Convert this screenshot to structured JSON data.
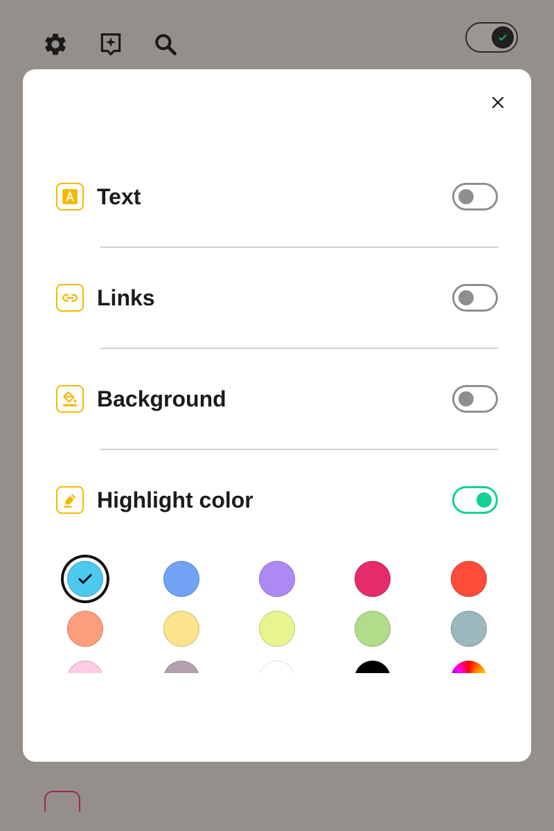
{
  "toolbar": {
    "settings_icon": "gear-icon",
    "sparkle_icon": "sparkle-icon",
    "search_icon": "search-icon",
    "dark_mode_toggle": {
      "state": "on",
      "icon": "check-icon"
    }
  },
  "panel": {
    "close_icon": "close-icon",
    "rows": [
      {
        "label": "Text",
        "icon": "text-a-icon",
        "enabled": false
      },
      {
        "label": "Links",
        "icon": "link-icon",
        "enabled": false
      },
      {
        "label": "Background",
        "icon": "paint-bucket-icon",
        "enabled": false
      },
      {
        "label": "Highlight color",
        "icon": "highlighter-icon",
        "enabled": true
      }
    ],
    "swatches": [
      {
        "color": "#4dc8ef",
        "selected": true
      },
      {
        "color": "#71a2f6",
        "selected": false
      },
      {
        "color": "#ad89f4",
        "selected": false
      },
      {
        "color": "#e52b6b",
        "selected": false
      },
      {
        "color": "#fd4c3a",
        "selected": false
      },
      {
        "color": "#fc9e7c",
        "selected": false
      },
      {
        "color": "#fce38c",
        "selected": false
      },
      {
        "color": "#e8f58f",
        "selected": false
      },
      {
        "color": "#b1dc8a",
        "selected": false
      },
      {
        "color": "#9cb7be",
        "selected": false
      },
      {
        "color": "#fccde4",
        "selected": false
      },
      {
        "color": "#b3a1b0",
        "selected": false
      },
      {
        "color": "#ffffff",
        "selected": false
      },
      {
        "color": "#000000",
        "selected": false
      },
      {
        "color": "rainbow",
        "selected": false
      }
    ]
  },
  "colors": {
    "accent_icon": "#f5b800",
    "toggle_on": "#0fd292",
    "toggle_off": "#8e8e8e",
    "overlay": "#958f8b"
  }
}
